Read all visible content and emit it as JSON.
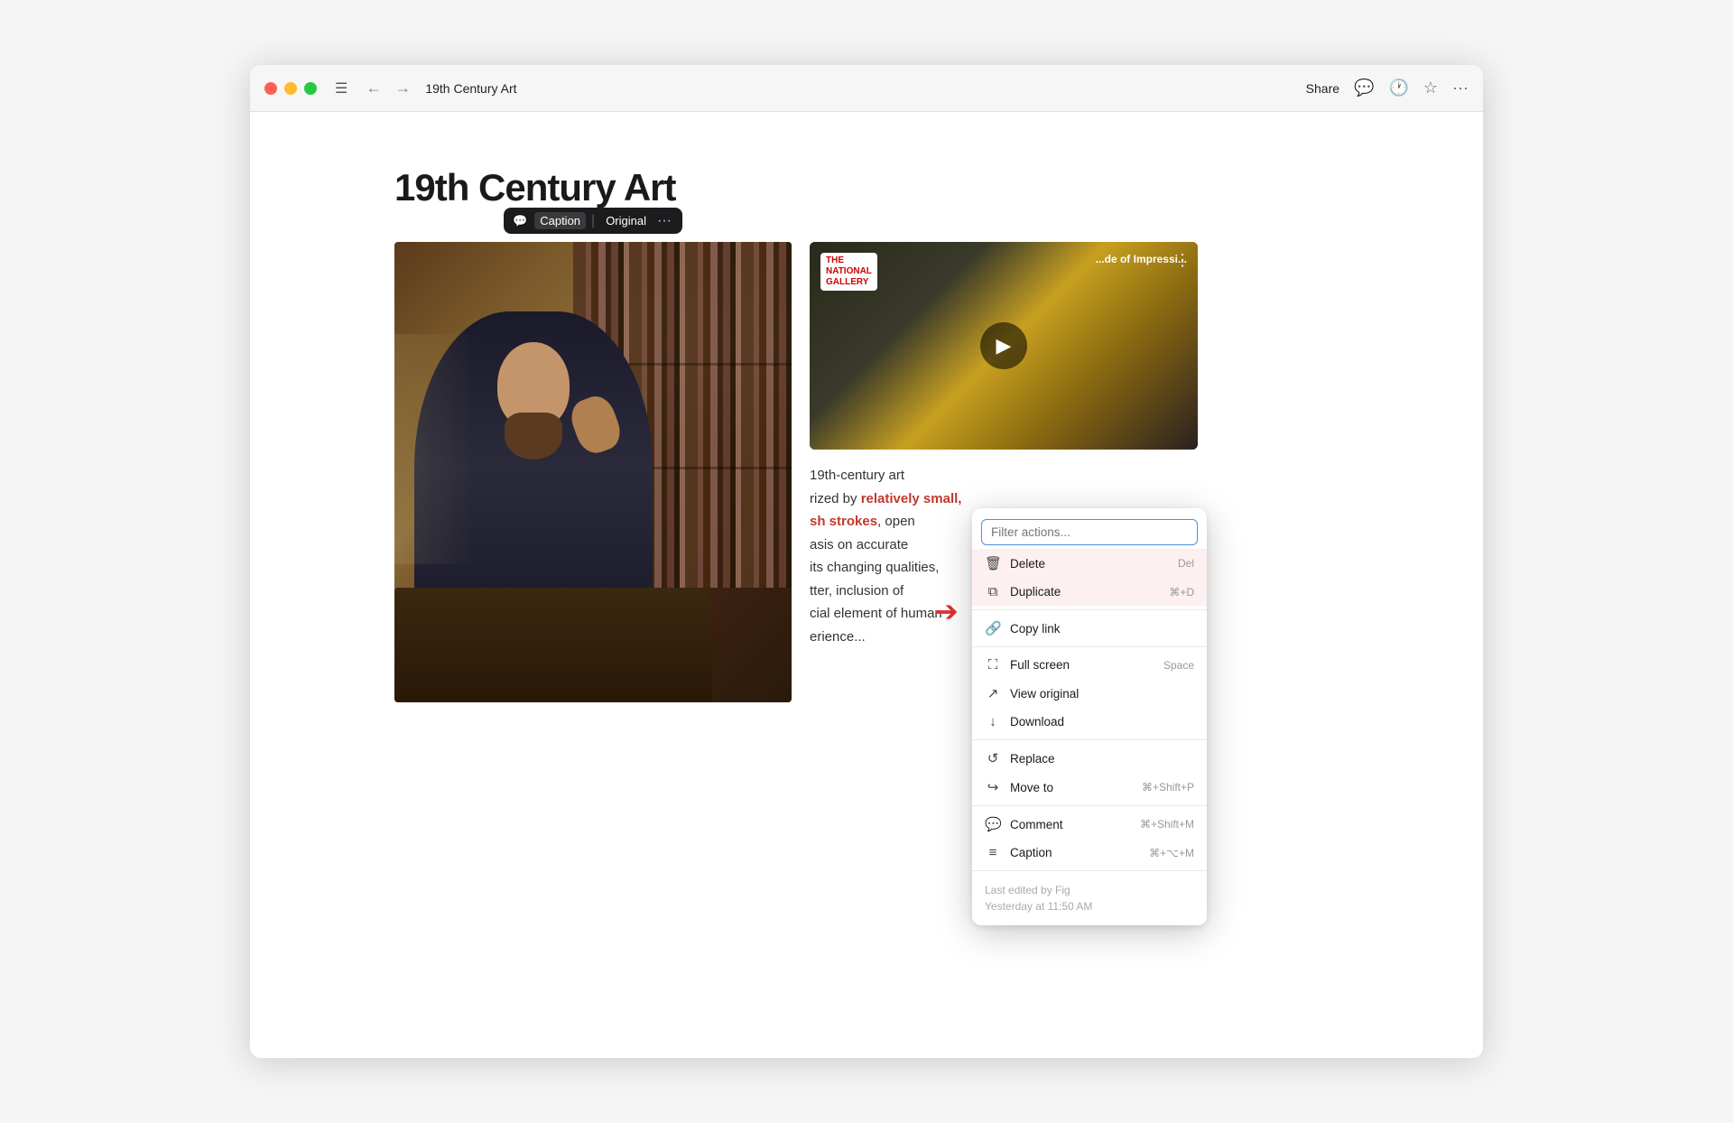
{
  "window": {
    "title": "19th Century Art",
    "traffic_lights": [
      "red",
      "yellow",
      "green"
    ]
  },
  "titlebar": {
    "share_label": "Share",
    "icons": [
      "chat-icon",
      "clock-icon",
      "star-icon",
      "more-icon"
    ]
  },
  "page": {
    "title": "19th Century Art"
  },
  "image_toolbar": {
    "caption_label": "Caption",
    "original_label": "Original"
  },
  "context_menu": {
    "search_placeholder": "Filter actions...",
    "items": [
      {
        "label": "Delete",
        "shortcut": "Del",
        "icon": "trash-icon"
      },
      {
        "label": "Duplicate",
        "shortcut": "⌘+D",
        "icon": "duplicate-icon"
      },
      {
        "label": "Copy link",
        "shortcut": "",
        "icon": "link-icon"
      },
      {
        "label": "Full screen",
        "shortcut": "Space",
        "icon": "fullscreen-icon"
      },
      {
        "label": "View original",
        "shortcut": "",
        "icon": "external-icon"
      },
      {
        "label": "Download",
        "shortcut": "",
        "icon": "download-icon"
      },
      {
        "label": "Replace",
        "shortcut": "",
        "icon": "replace-icon"
      },
      {
        "label": "Move to",
        "shortcut": "⌘+Shift+P",
        "icon": "moveto-icon"
      },
      {
        "label": "Comment",
        "shortcut": "⌘+Shift+M",
        "icon": "comment-icon"
      },
      {
        "label": "Caption",
        "shortcut": "⌘+⌥+M",
        "icon": "caption-icon"
      }
    ],
    "footer": {
      "line1": "Last edited by Fig",
      "line2": "Yesterday at 11:50 AM"
    }
  },
  "video": {
    "logo": "THE\nNATIONAL\nGALLERY",
    "title": "...de of Impressi...",
    "play_icon": "▶"
  },
  "body_text": {
    "line1": "19th-century art",
    "line2": "rized by ",
    "red1": "relatively small,",
    "line3": "h strokes",
    "line4": ", open",
    "line5": "asis on accurate",
    "line6": "its changing qualities,",
    "line7": "tter, inclusion of",
    "line8": "cial element of human",
    "line9": "erience..."
  }
}
